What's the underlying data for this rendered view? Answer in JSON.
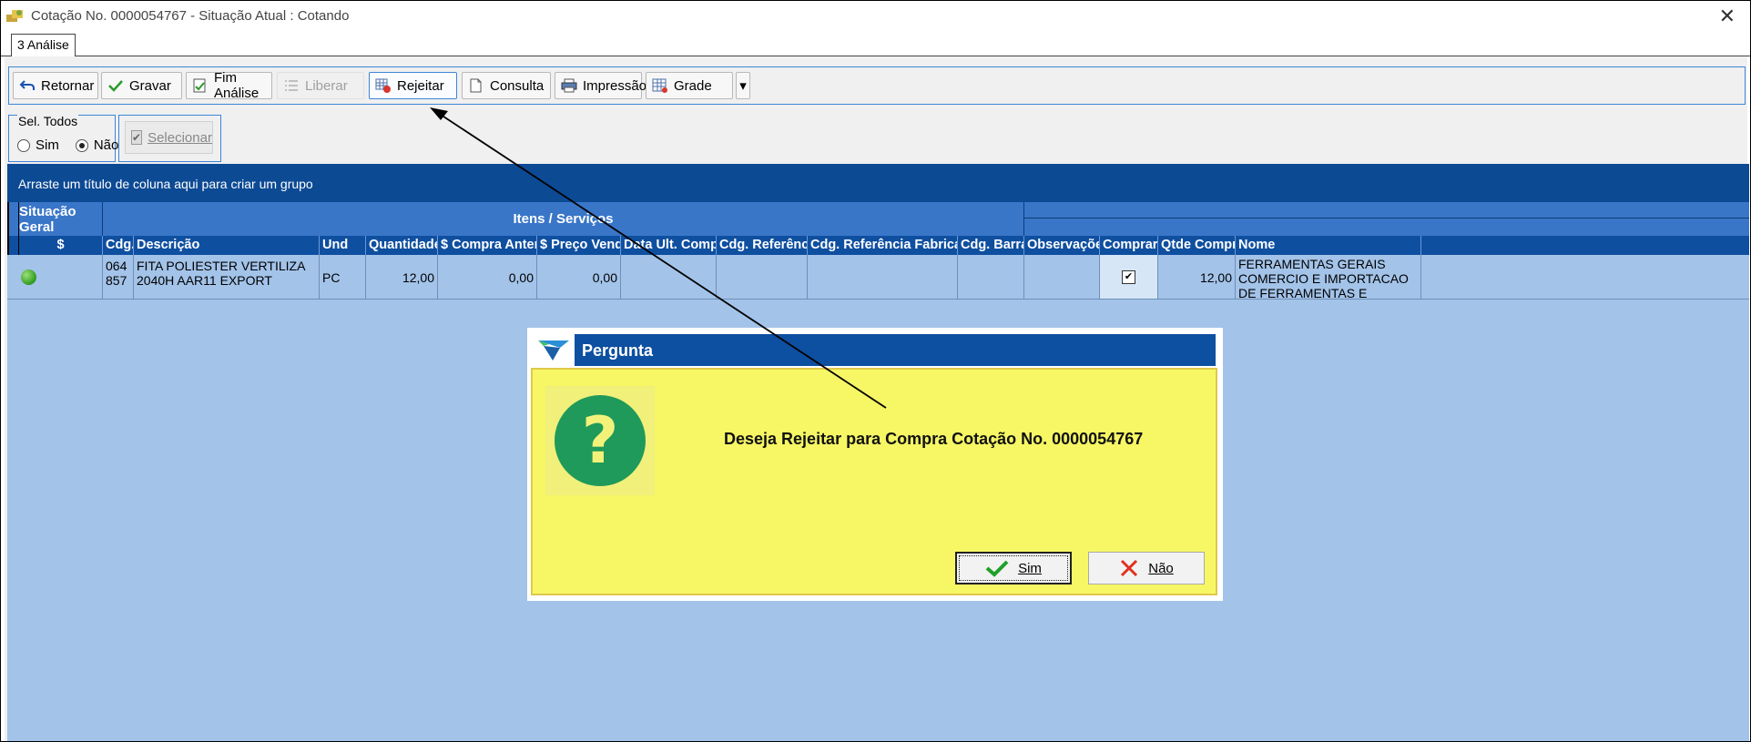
{
  "window": {
    "title": "Cotação No. 0000054767 - Situação Atual : Cotando",
    "close": "✕"
  },
  "tabs": [
    {
      "label": "3 Análise"
    }
  ],
  "toolbar": {
    "buttons": [
      {
        "label": "Retornar",
        "icon": "return-arrow-icon",
        "enabled": true
      },
      {
        "label": "Gravar",
        "icon": "check-icon",
        "enabled": true
      },
      {
        "label": "Fim Análise",
        "icon": "document-check-icon",
        "enabled": true
      },
      {
        "label": "Liberar",
        "icon": "list-icon",
        "enabled": false
      },
      {
        "label": "Rejeitar",
        "icon": "grid-reject-icon",
        "enabled": true
      },
      {
        "label": "Consulta",
        "icon": "document-icon",
        "enabled": true
      },
      {
        "label": "Impressão",
        "icon": "printer-icon",
        "enabled": true
      },
      {
        "label": "Grade",
        "icon": "grid-icon",
        "enabled": true
      }
    ],
    "more": "▾"
  },
  "sel_todos": {
    "legend": "Sel. Todos",
    "options": [
      {
        "label": "Sim",
        "checked": false
      },
      {
        "label": "Não",
        "checked": true
      }
    ]
  },
  "selecionar": {
    "label": "Selecionar",
    "enabled": false
  },
  "grid": {
    "group_hint": "Arraste um título de coluna aqui para criar um grupo",
    "bands": [
      "Situação Geral",
      "Itens / Serviços",
      ""
    ],
    "columns": [
      "$",
      "Cdg.",
      "Descrição",
      "Und",
      "Quantidade",
      "$ Compra Anterior",
      "$ Preço Venda",
      "Data Ult. Compra",
      "Cdg. Referência",
      "Cdg. Referência Fabricante",
      "Cdg. Barras",
      "Observações",
      "Comprar",
      "Qtde Comprar",
      "Nome"
    ],
    "rows": [
      {
        "status": "green",
        "cdg": "064857",
        "descricao": "FITA POLIESTER VERTILIZA 2040H AAR11 EXPORT",
        "und": "PC",
        "quantidade": "12,00",
        "compra_anterior": "0,00",
        "preco_venda": "0,00",
        "data_ult_compra": "",
        "cdg_referencia": "",
        "cdg_ref_fabricante": "",
        "cdg_barras": "",
        "observacoes": "",
        "comprar": true,
        "qtde_comprar": "12,00",
        "nome": "FERRAMENTAS GERAIS COMERCIO E IMPORTACAO DE FERRAMENTAS E MAQUINAS LTDA"
      }
    ]
  },
  "dialog": {
    "title": "Pergunta",
    "message": "Deseja Rejeitar para Compra Cotação No. 0000054767",
    "buttons": [
      {
        "label": "Sim",
        "icon": "green-check-icon"
      },
      {
        "label": "Não",
        "icon": "red-x-icon"
      }
    ]
  },
  "colors": {
    "accent": "#0d4fa0",
    "grid_bg": "#a3c3e9",
    "dialog_bg": "#f7f765"
  }
}
